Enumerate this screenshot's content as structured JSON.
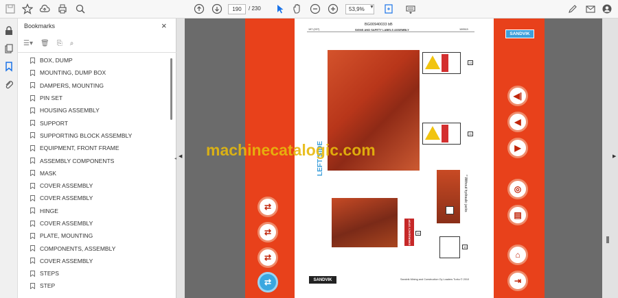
{
  "toolbar": {
    "page_current": "190",
    "page_total": "/ 230",
    "zoom": "53,9%"
  },
  "sidebar": {
    "title": "Bookmarks",
    "close_glyph": "×",
    "bookmarks": [
      "BOX, DUMP",
      "MOUNTING, DUMP BOX",
      "DAMPERS, MOUNTING",
      "PIN SET",
      "HOUSING ASSEMBLY",
      "SUPPORT",
      "SUPPORTING BLOCK ASSEMBLY",
      "EQUIPMENT, FRONT FRAME",
      "ASSEMBLY COMPONENTS",
      "MASK",
      "COVER ASSEMBLY",
      "COVER ASSEMBLY",
      "HINGE",
      "COVER ASSEMBLY",
      "PLATE, MOUNTING",
      "COMPONENTS, ASSEMBLY",
      "COVER ASSEMBLY",
      "STEPS",
      "STEP"
    ]
  },
  "document": {
    "logo": "SANDVIK",
    "code": "BG00940033 bB",
    "page_ref": "197 (227)",
    "title": "SIGNS AND SAFETY LABELS ASSEMBLY",
    "date": "100513",
    "side_label": "LEFT SIDE",
    "note": "* Without hydraulic jacks",
    "estop": "EMERGENCY STOP",
    "callouts": [
      "13",
      "11",
      "12",
      "10"
    ],
    "footer_logo": "SANDVIK",
    "footer": "Sandvik Mining and Construction Oy Loaders Turku © 2010"
  },
  "watermark": "machinecatalogic.com",
  "colors": {
    "strip": "#e8411b",
    "accent": "#3ea0db"
  }
}
